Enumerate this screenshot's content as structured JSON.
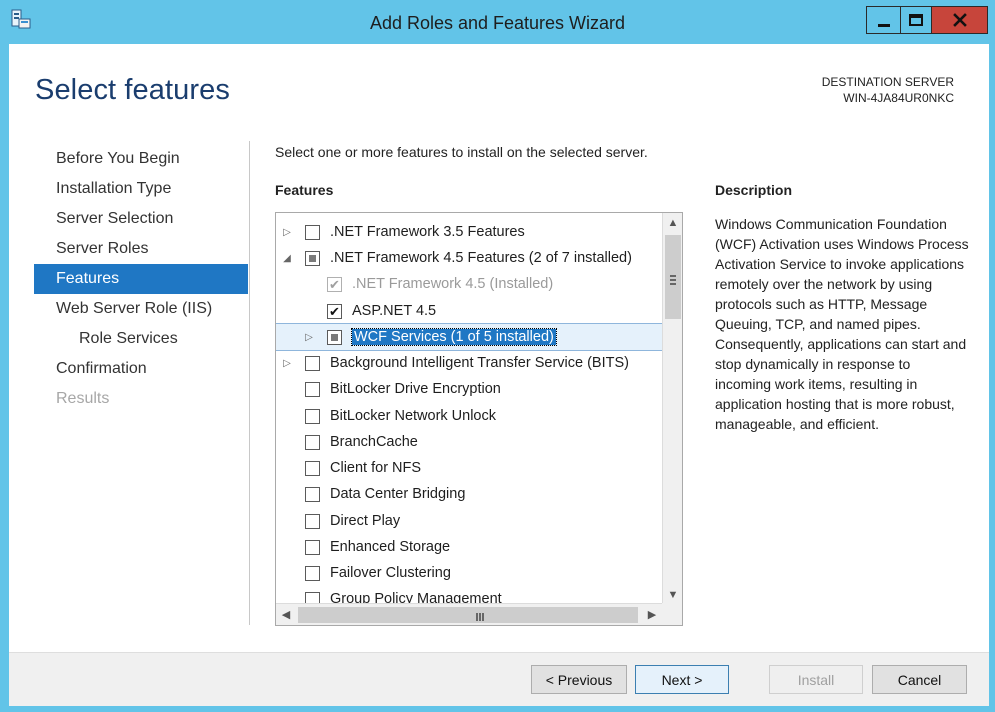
{
  "window": {
    "title": "Add Roles and Features Wizard",
    "icon": "server-manager-icon"
  },
  "page": {
    "title": "Select features",
    "destination_label": "DESTINATION SERVER",
    "destination_server": "WIN-4JA84UR0NKC"
  },
  "nav": {
    "items": [
      {
        "label": "Before You Begin",
        "state": "normal"
      },
      {
        "label": "Installation Type",
        "state": "normal"
      },
      {
        "label": "Server Selection",
        "state": "normal"
      },
      {
        "label": "Server Roles",
        "state": "normal"
      },
      {
        "label": "Features",
        "state": "active"
      },
      {
        "label": "Web Server Role (IIS)",
        "state": "normal"
      },
      {
        "label": "Role Services",
        "state": "sub"
      },
      {
        "label": "Confirmation",
        "state": "normal"
      },
      {
        "label": "Results",
        "state": "disabled"
      }
    ]
  },
  "content": {
    "instruction": "Select one or more features to install on the selected server.",
    "features_heading": "Features",
    "description_heading": "Description",
    "description": "Windows Communication Foundation (WCF) Activation uses Windows Process Activation Service to invoke applications remotely over the network by using protocols such as HTTP, Message Queuing, TCP, and named pipes. Consequently, applications can start and stop dynamically in response to incoming work items, resulting in application hosting that is more robust, manageable, and efficient."
  },
  "features": [
    {
      "label": ".NET Framework 3.5 Features",
      "level": 0,
      "expander": "collapsed",
      "state": "unchecked"
    },
    {
      "label": ".NET Framework 4.5 Features (2 of 7 installed)",
      "level": 0,
      "expander": "expanded",
      "state": "partial"
    },
    {
      "label": ".NET Framework 4.5 (Installed)",
      "level": 1,
      "expander": "none",
      "state": "checked-disabled"
    },
    {
      "label": "ASP.NET 4.5",
      "level": 1,
      "expander": "none",
      "state": "checked"
    },
    {
      "label": "WCF Services (1 of 5 installed)",
      "level": 1,
      "expander": "collapsed",
      "state": "partial",
      "selected": true
    },
    {
      "label": "Background Intelligent Transfer Service (BITS)",
      "level": 0,
      "expander": "collapsed",
      "state": "unchecked"
    },
    {
      "label": "BitLocker Drive Encryption",
      "level": 0,
      "expander": "none",
      "state": "unchecked"
    },
    {
      "label": "BitLocker Network Unlock",
      "level": 0,
      "expander": "none",
      "state": "unchecked"
    },
    {
      "label": "BranchCache",
      "level": 0,
      "expander": "none",
      "state": "unchecked"
    },
    {
      "label": "Client for NFS",
      "level": 0,
      "expander": "none",
      "state": "unchecked"
    },
    {
      "label": "Data Center Bridging",
      "level": 0,
      "expander": "none",
      "state": "unchecked"
    },
    {
      "label": "Direct Play",
      "level": 0,
      "expander": "none",
      "state": "unchecked"
    },
    {
      "label": "Enhanced Storage",
      "level": 0,
      "expander": "none",
      "state": "unchecked"
    },
    {
      "label": "Failover Clustering",
      "level": 0,
      "expander": "none",
      "state": "unchecked"
    },
    {
      "label": "Group Policy Management",
      "level": 0,
      "expander": "none",
      "state": "unchecked"
    }
  ],
  "buttons": {
    "previous": "< Previous",
    "next": "Next >",
    "install": "Install",
    "cancel": "Cancel"
  },
  "colors": {
    "frame": "#62c4e8",
    "accent": "#1f77c4",
    "title_text": "#1a3d6e",
    "close_button": "#c7453b"
  }
}
